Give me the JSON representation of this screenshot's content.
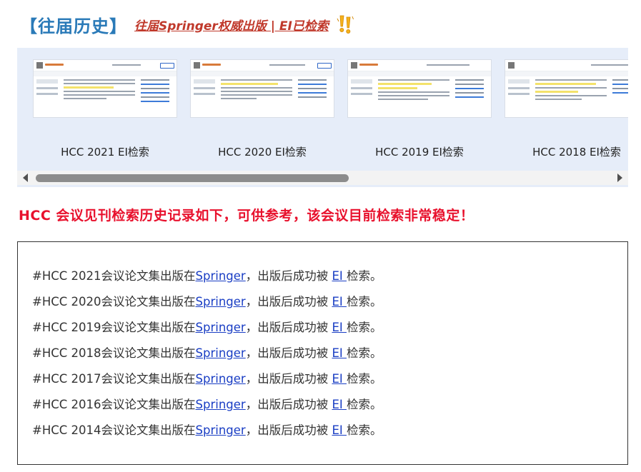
{
  "header": {
    "title": "【往届历史】",
    "link_text": "往届Springer权威出版 | EI已检索",
    "icon": "double-exclamation-icon"
  },
  "gallery": {
    "cards": [
      {
        "caption": "HCC 2021 EI检索"
      },
      {
        "caption": "HCC 2020 EI检索"
      },
      {
        "caption": "HCC 2019 EI检索"
      },
      {
        "caption": "HCC 2018 EI检索"
      }
    ]
  },
  "notice": "HCC 会议见刊检索历史记录如下，可供参考，该会议目前检索非常稳定！",
  "history": [
    {
      "prefix": "#HCC 2021会议论文集出版在",
      "publisher": "Springer",
      "middle": "，出版后成功被 ",
      "index": "EI ",
      "suffix": "检索。"
    },
    {
      "prefix": "#HCC 2020会议论文集出版在",
      "publisher": "Springer",
      "middle": "，出版后成功被 ",
      "index": "EI ",
      "suffix": "检索。"
    },
    {
      "prefix": "#HCC 2019会议论文集出版在",
      "publisher": "Springer",
      "middle": "，出版后成功被 ",
      "index": "EI ",
      "suffix": "检索。"
    },
    {
      "prefix": "#HCC 2018会议论文集出版在",
      "publisher": "Springer",
      "middle": "，出版后成功被 ",
      "index": "EI ",
      "suffix": "检索。"
    },
    {
      "prefix": "#HCC 2017会议论文集出版在",
      "publisher": "Springer",
      "middle": "，出版后成功被 ",
      "index": "EI ",
      "suffix": "检索。"
    },
    {
      "prefix": "#HCC 2016会议论文集出版在",
      "publisher": "Springer",
      "middle": "，出版后成功被 ",
      "index": "EI ",
      "suffix": "检索。"
    },
    {
      "prefix": "#HCC 2014会议论文集出版在",
      "publisher": "Springer",
      "middle": "，出版后成功被 ",
      "index": "EI ",
      "suffix": "检索。"
    }
  ],
  "colors": {
    "title_blue": "#2a7ab8",
    "link_red": "#c0392b",
    "notice_red": "#e8112d",
    "gallery_bg": "#e6edf9",
    "link_blue": "#1a3ec4"
  }
}
